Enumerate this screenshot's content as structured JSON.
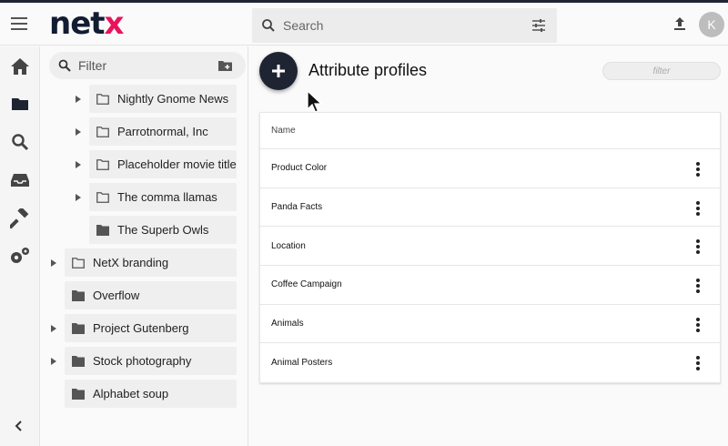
{
  "header": {
    "logo_main": "net",
    "logo_accent": "x",
    "search_placeholder": "Search",
    "avatar_initial": "K"
  },
  "rail": {
    "items": [
      "home-icon",
      "folder-icon",
      "search-icon",
      "inbox-icon",
      "hammer-icon",
      "gears-icon"
    ]
  },
  "folders": {
    "filter_placeholder": "Filter",
    "items": [
      {
        "label": "Nightly Gnome News",
        "depth": 1,
        "expandable": true,
        "filled": false
      },
      {
        "label": "Parrotnormal, Inc",
        "depth": 1,
        "expandable": true,
        "filled": false
      },
      {
        "label": "Placeholder movie title",
        "depth": 1,
        "expandable": true,
        "filled": false
      },
      {
        "label": "The comma llamas",
        "depth": 1,
        "expandable": true,
        "filled": false
      },
      {
        "label": "The Superb Owls",
        "depth": 1,
        "expandable": false,
        "filled": true
      },
      {
        "label": "NetX branding",
        "depth": 0,
        "expandable": true,
        "filled": false
      },
      {
        "label": "Overflow",
        "depth": 0,
        "expandable": false,
        "filled": true
      },
      {
        "label": "Project Gutenberg",
        "depth": 0,
        "expandable": true,
        "filled": true
      },
      {
        "label": "Stock photography",
        "depth": 0,
        "expandable": true,
        "filled": true
      },
      {
        "label": "Alphabet soup",
        "depth": 0,
        "expandable": false,
        "filled": true
      }
    ]
  },
  "main": {
    "title": "Attribute profiles",
    "filter_placeholder": "filter",
    "table_header": "Name",
    "rows": [
      "Product Color",
      "Panda Facts",
      "Location",
      "Coffee Campaign",
      "Animals",
      "Animal Posters"
    ]
  },
  "colors": {
    "brand_dark": "#1f2433",
    "brand_accent": "#e8145a"
  }
}
